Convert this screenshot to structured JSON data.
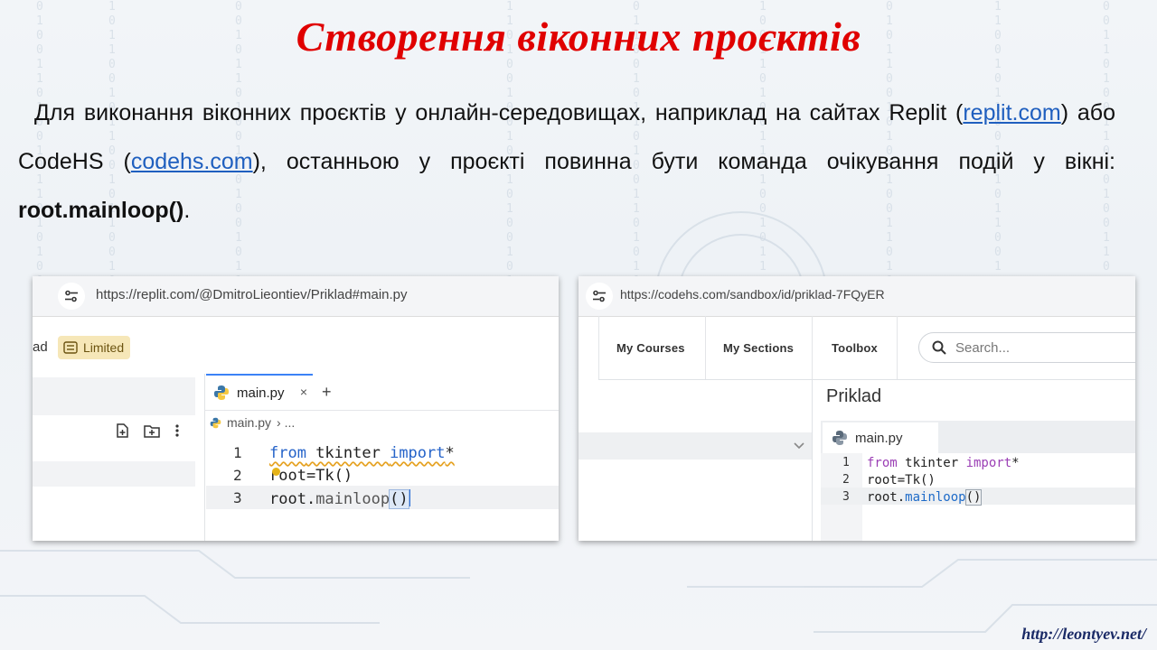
{
  "slide": {
    "title": "Створення віконних проєктів",
    "para_part1": "Для виконання віконних проєктів у онлайн-середовищах, наприклад на сайтах Replit (",
    "link_replit": "replit.com",
    "para_part2": ") або CodeHS (",
    "link_codehs": "codehs.com",
    "para_part3": "), останньою у проєкті повинна бути команда очікування подій у вікні: ",
    "para_bold": "root.mainloop()",
    "para_end": ".",
    "footer_link": "http://leontyev.net/"
  },
  "replit": {
    "url": "https://replit.com/@DmitroLieontiev/Priklad#main.py",
    "left_label": "ad",
    "badge_label": "Limited",
    "tab_label": "main.py",
    "tab_close": "×",
    "tab_add": "+",
    "breadcrumb_file": "main.py",
    "breadcrumb_more": "› ...",
    "line_numbers": [
      "1",
      "2",
      "3"
    ],
    "code": {
      "l1_kw1": "from",
      "l1_mod": " tkinter ",
      "l1_kw2": "import",
      "l1_star": "*",
      "l2": "root=Tk()",
      "l3_obj": "root.",
      "l3_fn": "mainloop",
      "l3_paren": "()"
    }
  },
  "codehs": {
    "url": "https://codehs.com/sandbox/id/priklad-7FQyER",
    "nav": [
      "My Courses",
      "My Sections",
      "Toolbox"
    ],
    "search_placeholder": "Search...",
    "project_title": "Priklad",
    "tab_label": "main.py",
    "line_numbers": [
      "1",
      "2",
      "3"
    ],
    "code": {
      "l1_kw1": "from",
      "l1_mod": " tkinter ",
      "l1_kw2": "import",
      "l1_star": "*",
      "l2": "root=Tk()",
      "l3_obj": "root.",
      "l3_fn": "mainloop",
      "l3_paren": "()"
    }
  },
  "colors": {
    "title": "#e00000",
    "link": "#1f5fbf",
    "replit_keyword": "#2563c9",
    "codehs_keyword": "#9b3fb5",
    "codehs_function": "#1d6ac8",
    "badge_bg": "#f6e7b8"
  }
}
